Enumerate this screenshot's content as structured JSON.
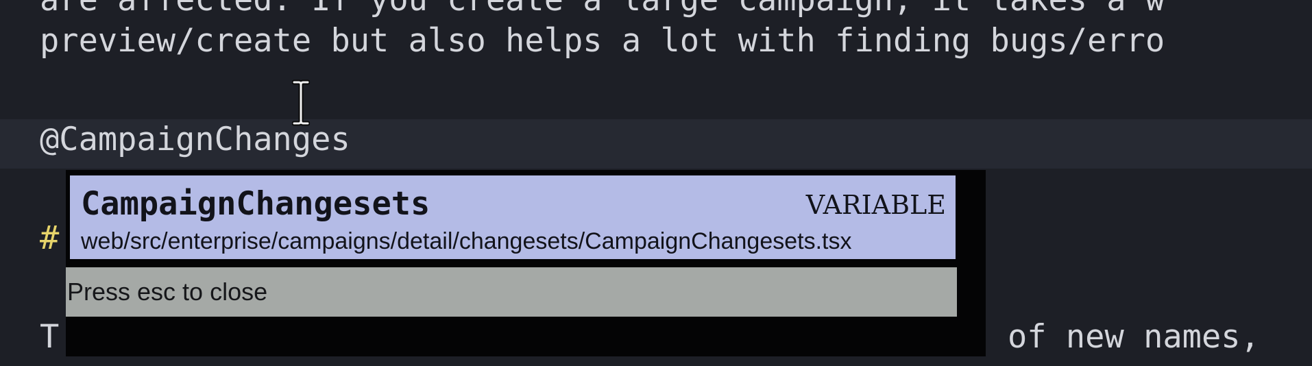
{
  "editor": {
    "line_top_partial": "are affected. If you create a large campaign, it takes a w",
    "line_preview": "preview/create but also helps a lot with finding bugs/erro",
    "line_current": "@CampaignChanges",
    "line_heading": "#",
    "line_tail_left": "T",
    "line_tail_right": "of new names,"
  },
  "autocomplete": {
    "suggestion": {
      "name": "CampaignChangesets",
      "kind": "VARIABLE",
      "path": "web/src/enterprise/campaigns/detail/changesets/CampaignChangesets.tsx"
    },
    "hint": "Press esc to close"
  },
  "icons": {
    "cursor": "text-cursor-ibeam-icon"
  },
  "colors": {
    "background": "#1d1f26",
    "current_line": "#262932",
    "suggestion_bg": "#b4bbe6",
    "hint_bg": "#a5a9a6",
    "heading": "#e6d36a"
  }
}
